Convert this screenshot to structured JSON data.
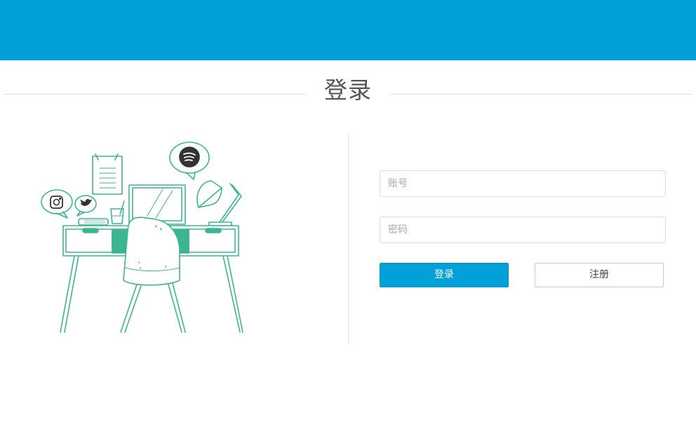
{
  "header": {
    "title": "登录"
  },
  "form": {
    "account_placeholder": "账号",
    "account_value": "",
    "password_placeholder": "密码",
    "password_value": "",
    "login_label": "登录",
    "register_label": "注册"
  },
  "illustration": {
    "icons": [
      "instagram-icon",
      "twitter-icon",
      "spotify-icon"
    ]
  },
  "colors": {
    "topbar": "#00a0d9",
    "primary_button": "#00a0d9",
    "illustration_stroke": "#3db591"
  }
}
